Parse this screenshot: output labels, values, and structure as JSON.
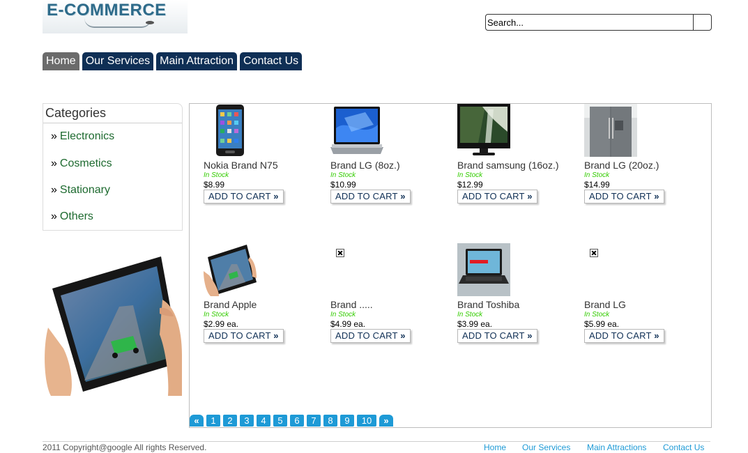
{
  "logo": {
    "text": "E-COMMERCE"
  },
  "search": {
    "placeholder": "Search..."
  },
  "nav": [
    {
      "label": "Home",
      "active": true
    },
    {
      "label": "Our Services",
      "active": false
    },
    {
      "label": "Main Attraction",
      "active": false
    },
    {
      "label": "Contact Us",
      "active": false
    }
  ],
  "categories": {
    "title": "Categories",
    "bullet": "»",
    "items": [
      "Electronics",
      "Cosmetics",
      "Stationary",
      "Others"
    ]
  },
  "products": [
    {
      "name": "Nokia Brand N75",
      "stock": "In Stock",
      "price": "$8.99",
      "cart": "ADD TO CART",
      "image": "phone-image"
    },
    {
      "name": "Brand LG (8oz.)",
      "stock": "In Stock",
      "price": "$10.99",
      "cart": "ADD TO CART",
      "image": "laptop-image"
    },
    {
      "name": "Brand samsung (16oz.)",
      "stock": "In Stock",
      "price": "$12.99",
      "cart": "ADD TO CART",
      "image": "tv-image"
    },
    {
      "name": "Brand LG (20oz.)",
      "stock": "In Stock",
      "price": "$14.99",
      "cart": "ADD TO CART",
      "image": "fridge-image"
    },
    {
      "name": "Brand Apple",
      "stock": "In Stock",
      "price": "$2.99 ea.",
      "cart": "ADD TO CART",
      "image": "tablet-image"
    },
    {
      "name": "Brand .....",
      "stock": "In Stock",
      "price": "$4.99 ea.",
      "cart": "ADD TO CART",
      "image": "broken-image-icon"
    },
    {
      "name": "Brand Toshiba",
      "stock": "In Stock",
      "price": "$3.99 ea.",
      "cart": "ADD TO CART",
      "image": "toshiba-laptop-image"
    },
    {
      "name": "Brand LG",
      "stock": "In Stock",
      "price": "$5.99 ea.",
      "cart": "ADD TO CART",
      "image": "broken-image-icon"
    }
  ],
  "cart_arrow": "»",
  "pagination": {
    "prev": "«",
    "pages": [
      "1",
      "2",
      "3",
      "4",
      "5",
      "6",
      "7",
      "8",
      "9",
      "10"
    ],
    "next": "»"
  },
  "footer": {
    "copyright": "2011 Copyright@google All rights Reserved.",
    "links": [
      "Home",
      "Our Services",
      "Main Attractions",
      "Contact Us"
    ]
  },
  "colors": {
    "nav_bg": "#0f2f55",
    "nav_active": "#6b6b6b",
    "category_link": "#1d6a2f",
    "stock": "#33cc00",
    "pager": "#1e9ad6",
    "footer_link": "#1e9ad6"
  }
}
